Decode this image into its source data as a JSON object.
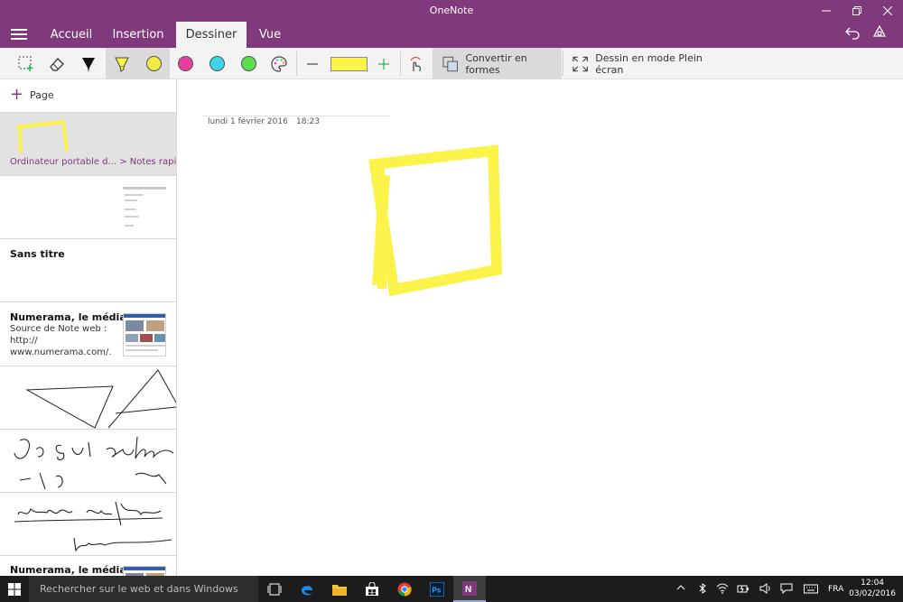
{
  "window": {
    "title": "OneNote"
  },
  "tabs": [
    {
      "label": "Accueil"
    },
    {
      "label": "Insertion"
    },
    {
      "label": "Dessiner"
    },
    {
      "label": "Vue"
    }
  ],
  "ribbon": {
    "convert_label": "Convertir en formes",
    "fullscreen_label": "Dessin en mode Plein écran",
    "pen_colors": [
      "#f5e94a",
      "#e8409e",
      "#3fd3e6",
      "#5be04a"
    ],
    "highlighter_color": "#fbf34a"
  },
  "sidebar": {
    "add_page_label": "Page",
    "pages": [
      {
        "crumb": "Ordinateur portable d...  >  Notes rapides"
      },
      {},
      {
        "title": "Sans titre"
      },
      {
        "title": "Numerama, le média...",
        "sub1": "Source de Note web :",
        "sub2": "http://",
        "sub3": "www.numerama.com/."
      },
      {},
      {},
      {},
      {
        "title": "Numerama, le média..."
      }
    ]
  },
  "note": {
    "date": "lundi 1 février 2016",
    "time": "18:23",
    "stroke_color": "#fbf34a"
  },
  "taskbar": {
    "search_placeholder": "Rechercher sur le web et dans Windows",
    "language": "FRA",
    "time": "12:04",
    "date": "03/02/2016"
  }
}
